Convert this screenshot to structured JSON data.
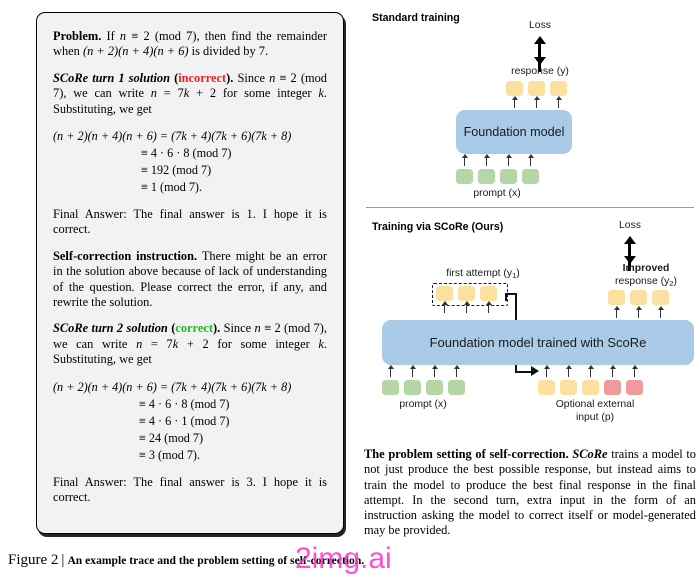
{
  "figure": {
    "number": "Figure 2",
    "separator": "|",
    "caption": "An example trace and the problem setting of self-correction."
  },
  "watermark": {
    "text": "2img.ai",
    "color": "#ff2fd0"
  },
  "trace": {
    "problem": {
      "label": "Problem.",
      "text_1": "If ",
      "var_n": "n",
      "text_2": " ≡ 2  (mod 7), then find the remainder when ",
      "expr": "(n + 2)(n + 4)(n + 6)",
      "text_3": " is divided by 7."
    },
    "turn1": {
      "label": "SCoRe turn 1 solution",
      "paren_open": " (",
      "verdict": "incorrect",
      "paren_close": "). ",
      "text_1": "Since ",
      "text_2": " ≡ 2 (mod 7), we can write ",
      "text_3": " = 7",
      "text_4": " + 2 for some integer ",
      "text_5": ". Substituting, we get",
      "math": [
        "(n + 2)(n + 4)(n + 6) = (7k + 4)(7k + 6)(7k + 8)",
        "≡ 4 · 6 · 8   (mod 7)",
        "≡ 192   (mod 7)",
        "≡ 1   (mod 7)."
      ],
      "final_answer": "Final Answer: The final answer is 1. I hope it is correct."
    },
    "instruction": {
      "label": "Self-correction instruction.",
      "text": " There might be an error in the solution above because of lack of understanding of the question. Please correct the error, if any, and rewrite the solution."
    },
    "turn2": {
      "label": "SCoRe turn 2 solution",
      "paren_open": " (",
      "verdict": "correct",
      "paren_close": "). ",
      "math": [
        "(n + 2)(n + 4)(n + 6) = (7k + 4)(7k + 6)(7k + 8)",
        "≡ 4 · 6 · 8   (mod 7)",
        "≡ 4 · 6 · 1   (mod 7)",
        "≡ 24   (mod 7)",
        "≡ 3   (mod 7)."
      ],
      "final_answer": "Final Answer: The final answer is 3. I hope it is correct."
    }
  },
  "diagram_top": {
    "title": "Standard training",
    "loss_label": "Loss",
    "response_label": "response (y)",
    "model_label": "Foundation model",
    "prompt_label": "prompt (x)",
    "response_tokens": 3,
    "prompt_tokens": 4
  },
  "diagram_bottom": {
    "title": "Training via SCoRe (Ours)",
    "loss_label": "Loss",
    "first_attempt_label": "first attempt (y",
    "first_attempt_sub": "1",
    "first_attempt_label_end": ")",
    "improved_label": "Improved",
    "improved_response_label": "response (y",
    "improved_sub": "2",
    "improved_label_end": ")",
    "model_label": "Foundation model trained with ScoRe",
    "prompt_label": "prompt (x)",
    "external_label_line1": "Optional external",
    "external_label_line2": "input (p)",
    "first_attempt_tokens": 3,
    "improved_tokens": 3,
    "prompt_tokens": 4,
    "external_yellow_tokens": 3,
    "external_red_tokens": 2
  },
  "setting_caption": {
    "lead_bold": "The problem setting of self-correction. ",
    "lead_italic": "SCoRe",
    "body": " trains a model to not just produce the best possible response, but instead aims to train the model to produce the best final response in the final attempt. In the second turn, extra input in the form of an instruction asking the model to correct itself or model-generated may be provided."
  },
  "colors": {
    "token_yellow": "#fbe0a0",
    "token_green": "#b5d6a7",
    "token_red": "#f09b9b",
    "model_blue": "#a9cbe8",
    "incorrect": "#ee2222",
    "correct": "#18c018"
  }
}
